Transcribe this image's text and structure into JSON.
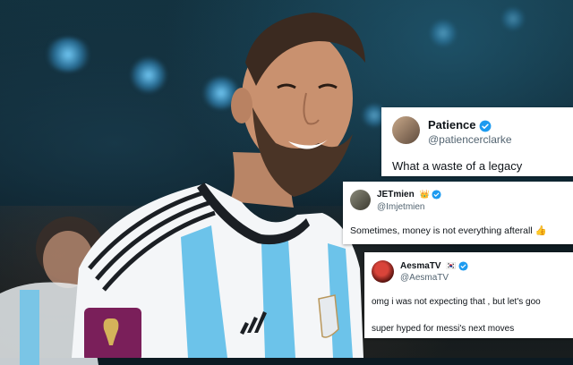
{
  "tweets": [
    {
      "name": "Patience",
      "handle": "@patiencerclarke",
      "text": "What a waste of a legacy",
      "avatar_icon": "profile-photo-icon"
    },
    {
      "name": "JETmien",
      "name_badge": "👑",
      "handle": "@Imjetmien",
      "text": "Sometimes, money is not everything afterall 👍",
      "avatar_icon": "profile-photo-icon"
    },
    {
      "name": "AesmaTV",
      "name_badge": "🇰🇷",
      "handle": "@AesmaTV",
      "text_line1": "omg i was not expecting that , but let's goo",
      "text_line2": "super hyped for messi's next moves",
      "avatar_icon": "profile-photo-icon"
    }
  ],
  "colors": {
    "verified": "#1d9bf0",
    "argentina_blue": "#6cc3ea",
    "jersey_white": "#f4f6f8"
  }
}
